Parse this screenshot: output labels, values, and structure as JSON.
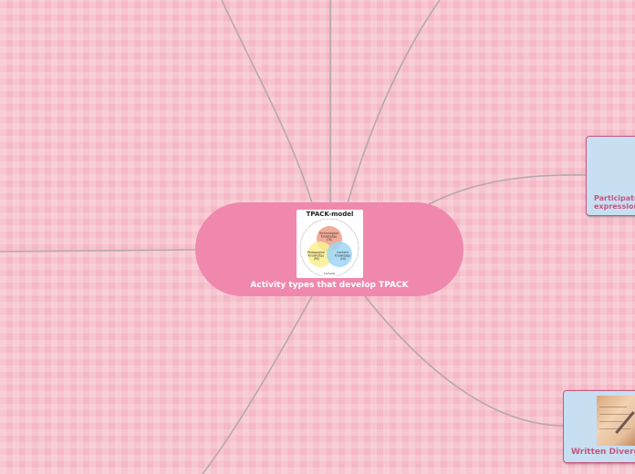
{
  "central_topic": {
    "title": "Activity types that develop TPACK",
    "image": {
      "heading": "TPACK-model",
      "circles": [
        {
          "label_lines": [
            "Technological",
            "Knowledge",
            "(TK)"
          ],
          "color": "#f0a38e"
        },
        {
          "label_lines": [
            "Pedagogical",
            "Knowledge",
            "(PK)"
          ],
          "color": "#fbee8e"
        },
        {
          "label_lines": [
            "Content",
            "Knowledge",
            "(CK)"
          ],
          "color": "#9ed6f4"
        }
      ],
      "footer": "Contexts"
    }
  },
  "nodes": {
    "participatory": {
      "label_lines": [
        "Participatory",
        "expression"
      ]
    },
    "written": {
      "label": "Written Divergent"
    }
  },
  "colors": {
    "background": "#f4b8c6",
    "central": "#f088ad",
    "node_fill": "#c7dff1",
    "node_border": "#c4577f",
    "connector": "#b6a8ad"
  }
}
